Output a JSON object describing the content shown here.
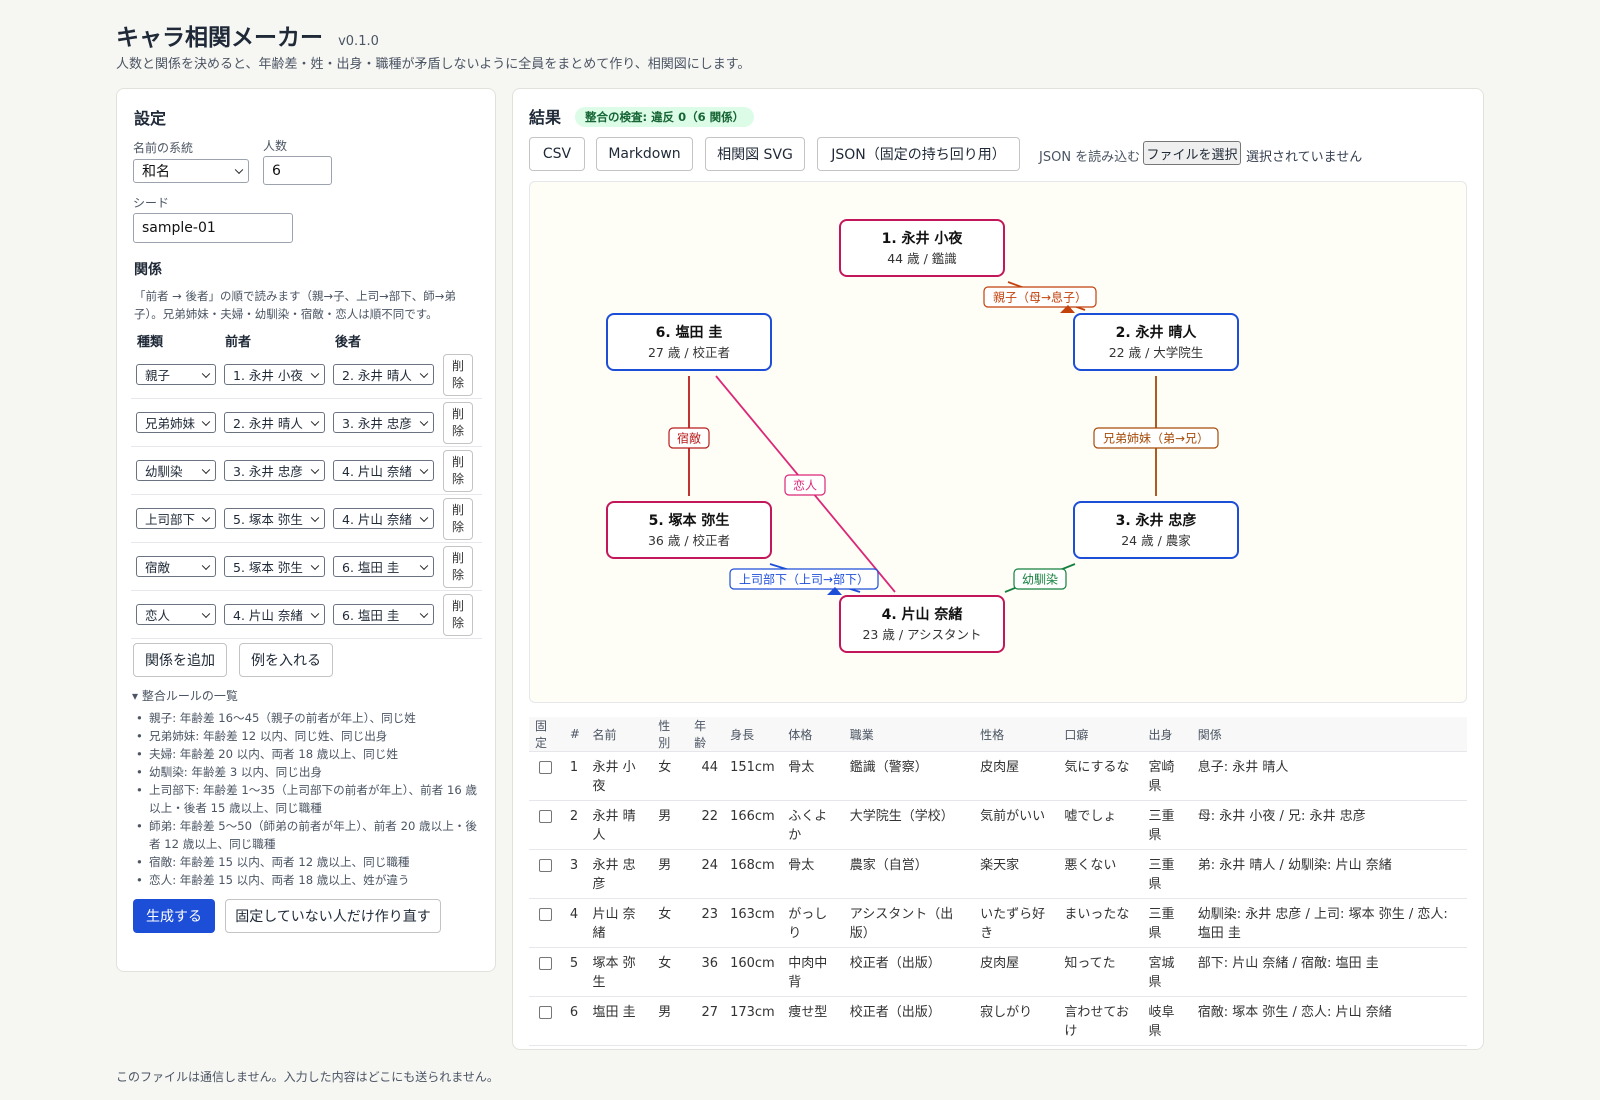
{
  "app": {
    "title": "キャラ相関メーカー",
    "version": "v0.1.0",
    "subtitle": "人数と関係を決めると、年齢差・姓・出身・職種が矛盾しないように全員をまとめて作り、相関図にします。",
    "footer": "このファイルは通信しません。入力した内容はどこにも送られません。"
  },
  "settings": {
    "title": "設定",
    "name_system_label": "名前の系統",
    "name_system_value": "和名",
    "count_label": "人数",
    "count_value": "6",
    "seed_label": "シード",
    "seed_value": "sample-01",
    "relations_title": "関係",
    "relations_note": "「前者 → 後者」の順で読みます（親→子、上司→部下、師→弟子）。兄弟姉妹・夫婦・幼馴染・宿敵・恋人は順不同です。",
    "col_type": "種類",
    "col_first": "前者",
    "col_second": "後者",
    "delete_label": "削除",
    "relations": [
      {
        "type": "親子",
        "first": "1. 永井 小夜",
        "second": "2. 永井 晴人"
      },
      {
        "type": "兄弟姉妹",
        "first": "2. 永井 晴人",
        "second": "3. 永井 忠彦"
      },
      {
        "type": "幼馴染",
        "first": "3. 永井 忠彦",
        "second": "4. 片山 奈緒"
      },
      {
        "type": "上司部下",
        "first": "5. 塚本 弥生",
        "second": "4. 片山 奈緒"
      },
      {
        "type": "宿敵",
        "first": "5. 塚本 弥生",
        "second": "6. 塩田 圭"
      },
      {
        "type": "恋人",
        "first": "4. 片山 奈緒",
        "second": "6. 塩田 圭"
      }
    ],
    "add_relation": "関係を追加",
    "insert_example": "例を入れる",
    "rules_summary": "▾ 整合ルールの一覧",
    "rules": [
      "親子: 年齢差 16〜45（親子の前者が年上）、同じ姓",
      "兄弟姉妹: 年齢差 12 以内、同じ姓、同じ出身",
      "夫婦: 年齢差 20 以内、両者 18 歳以上、同じ姓",
      "幼馴染: 年齢差 3 以内、同じ出身",
      "上司部下: 年齢差 1〜35（上司部下の前者が年上）、前者 16 歳以上・後者 15 歳以上、同じ職種",
      "師弟: 年齢差 5〜50（師弟の前者が年上）、前者 20 歳以上・後者 12 歳以上、同じ職種",
      "宿敵: 年齢差 15 以内、両者 12 歳以上、同じ職種",
      "恋人: 年齢差 15 以内、両者 18 歳以上、姓が違う"
    ],
    "generate": "生成する",
    "regenerate": "固定していない人だけ作り直す"
  },
  "results": {
    "title": "結果",
    "badge": "整合の検査: 違反 0（6 関係）",
    "export_buttons": [
      "CSV",
      "Markdown",
      "相関図 SVG",
      "JSON（固定の持ち回り用）"
    ],
    "json_load_label": "JSON を読み込む",
    "file_button": "ファイルを選択",
    "file_status": "選択されていません"
  },
  "diagram": {
    "nodes": [
      {
        "name": "1. 永井 小夜",
        "sub": "44 歳 / 鑑識",
        "color": "#c2185b"
      },
      {
        "name": "2. 永井 晴人",
        "sub": "22 歳 / 大学院生",
        "color": "#1d4ed8"
      },
      {
        "name": "3. 永井 忠彦",
        "sub": "24 歳 / 農家",
        "color": "#1d4ed8"
      },
      {
        "name": "4. 片山 奈緒",
        "sub": "23 歳 / アシスタント",
        "color": "#c2185b"
      },
      {
        "name": "5. 塚本 弥生",
        "sub": "36 歳 / 校正者",
        "color": "#c2185b"
      },
      {
        "name": "6. 塩田 圭",
        "sub": "27 歳 / 校正者",
        "color": "#1d4ed8"
      }
    ],
    "edges": [
      {
        "label": "親子（母→息子）",
        "color": "#c2410c"
      },
      {
        "label": "兄弟姉妹（弟→兄）",
        "color": "#a64b0a"
      },
      {
        "label": "幼馴染",
        "color": "#15803d"
      },
      {
        "label": "上司部下（上司→部下）",
        "color": "#1d4ed8"
      },
      {
        "label": "宿敵",
        "color": "#b91c1c"
      },
      {
        "label": "恋人",
        "color": "#db2777"
      }
    ]
  },
  "table": {
    "headers": [
      "固定",
      "#",
      "名前",
      "性別",
      "年齢",
      "身長",
      "体格",
      "職業",
      "性格",
      "口癖",
      "出身",
      "関係"
    ],
    "rows": [
      {
        "no": "1",
        "name": "永井 小夜",
        "gender": "女",
        "age": "44",
        "height": "151cm",
        "build": "骨太",
        "job": "鑑識（警察）",
        "personality": "皮肉屋",
        "phrase": "気にするな",
        "origin": "宮崎県",
        "relations": "息子: 永井 晴人"
      },
      {
        "no": "2",
        "name": "永井 晴人",
        "gender": "男",
        "age": "22",
        "height": "166cm",
        "build": "ふくよか",
        "job": "大学院生（学校）",
        "personality": "気前がいい",
        "phrase": "嘘でしょ",
        "origin": "三重県",
        "relations": "母: 永井 小夜 / 兄: 永井 忠彦"
      },
      {
        "no": "3",
        "name": "永井 忠彦",
        "gender": "男",
        "age": "24",
        "height": "168cm",
        "build": "骨太",
        "job": "農家（自営）",
        "personality": "楽天家",
        "phrase": "悪くない",
        "origin": "三重県",
        "relations": "弟: 永井 晴人 / 幼馴染: 片山 奈緒"
      },
      {
        "no": "4",
        "name": "片山 奈緒",
        "gender": "女",
        "age": "23",
        "height": "163cm",
        "build": "がっしり",
        "job": "アシスタント（出版）",
        "personality": "いたずら好き",
        "phrase": "まいったな",
        "origin": "三重県",
        "relations": "幼馴染: 永井 忠彦 / 上司: 塚本 弥生 / 恋人: 塩田 圭"
      },
      {
        "no": "5",
        "name": "塚本 弥生",
        "gender": "女",
        "age": "36",
        "height": "160cm",
        "build": "中肉中背",
        "job": "校正者（出版）",
        "personality": "皮肉屋",
        "phrase": "知ってた",
        "origin": "宮城県",
        "relations": "部下: 片山 奈緒 / 宿敵: 塩田 圭"
      },
      {
        "no": "6",
        "name": "塩田 圭",
        "gender": "男",
        "age": "27",
        "height": "173cm",
        "build": "痩せ型",
        "job": "校正者（出版）",
        "personality": "寂しがり",
        "phrase": "言わせておけ",
        "origin": "岐阜県",
        "relations": "宿敵: 塚本 弥生 / 恋人: 片山 奈緒"
      }
    ]
  }
}
